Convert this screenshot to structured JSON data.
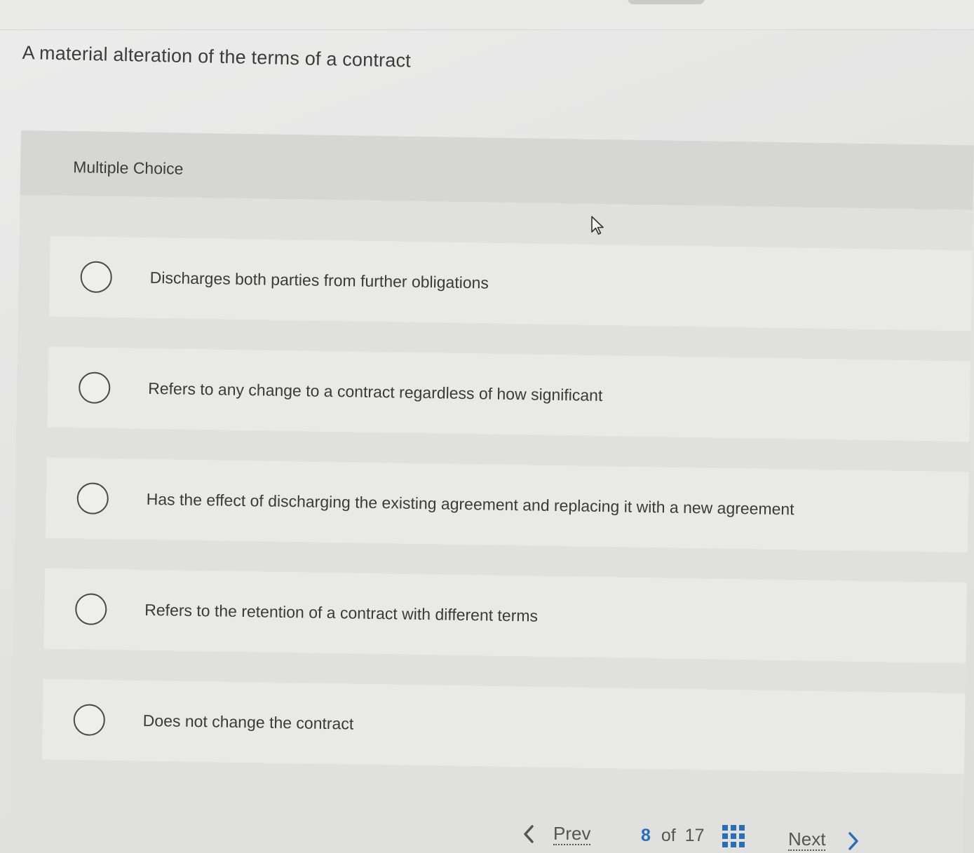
{
  "question": {
    "text": "A material alteration of the terms of a contract"
  },
  "panel": {
    "type_label": "Multiple Choice"
  },
  "options": [
    {
      "text": "Discharges both parties from further obligations",
      "selected": false
    },
    {
      "text": "Refers to any change to a contract regardless of how significant",
      "selected": false
    },
    {
      "text": "Has the effect of discharging the existing agreement and replacing it with a new agreement",
      "selected": false
    },
    {
      "text": "Refers to the retention of a contract with different terms",
      "selected": false
    },
    {
      "text": "Does not change the contract",
      "selected": false
    }
  ],
  "navigation": {
    "prev_label": "Prev",
    "current_page": "8",
    "of_label": "of",
    "total_pages": "17",
    "next_label": "Next",
    "prev_icon": "chevron-left-icon",
    "next_icon": "chevron-right-icon",
    "grid_icon": "question-grid-icon",
    "accent_color": "#2a6fb5"
  },
  "cursor_icon": "mouse-pointer-icon"
}
